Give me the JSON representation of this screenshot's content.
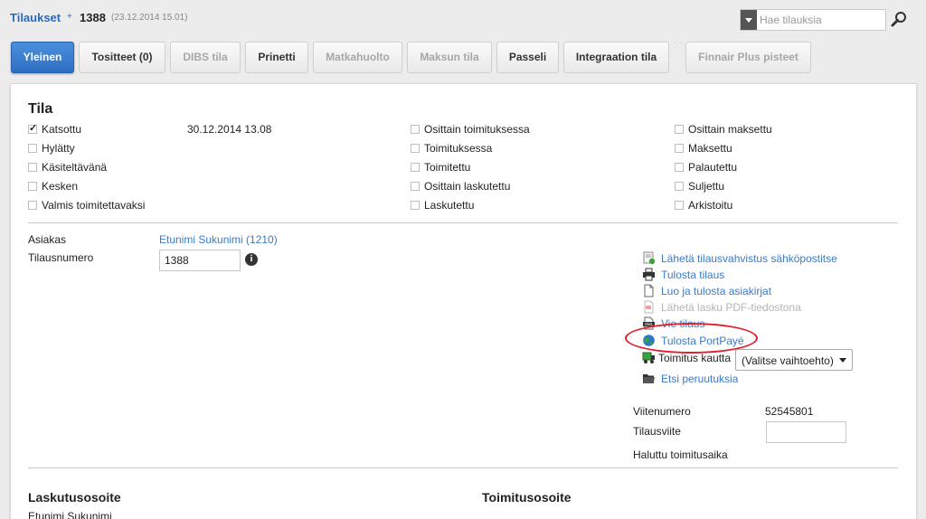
{
  "breadcrumb": {
    "root": "Tilaukset",
    "separator": "+",
    "order_number": "1388",
    "order_date": "(23.12.2014 15.01)"
  },
  "search": {
    "placeholder": "Hae tilauksia",
    "value": ""
  },
  "tabs": [
    {
      "label": "Yleinen",
      "state": "active"
    },
    {
      "label": "Tositteet (0)",
      "state": "enabled"
    },
    {
      "label": "DIBS tila",
      "state": "disabled"
    },
    {
      "label": "Prinetti",
      "state": "enabled"
    },
    {
      "label": "Matkahuolto",
      "state": "disabled"
    },
    {
      "label": "Maksun tila",
      "state": "disabled"
    },
    {
      "label": "Passeli",
      "state": "enabled"
    },
    {
      "label": "Integraation tila",
      "state": "enabled"
    },
    {
      "label": "Finnair Plus pisteet",
      "state": "disabled"
    }
  ],
  "status": {
    "heading": "Tila",
    "checked_date": "30.12.2014 13.08",
    "col1": [
      {
        "label": "Katsottu",
        "checked": true
      },
      {
        "label": "Hylätty",
        "checked": false
      },
      {
        "label": "Käsiteltävänä",
        "checked": false
      },
      {
        "label": "Kesken",
        "checked": false
      },
      {
        "label": "Valmis toimitettavaksi",
        "checked": false
      }
    ],
    "col2": [
      {
        "label": "Osittain toimituksessa",
        "checked": false
      },
      {
        "label": "Toimituksessa",
        "checked": false
      },
      {
        "label": "Toimitettu",
        "checked": false
      },
      {
        "label": "Osittain laskutettu",
        "checked": false
      },
      {
        "label": "Laskutettu",
        "checked": false
      }
    ],
    "col3": [
      {
        "label": "Osittain maksettu",
        "checked": false
      },
      {
        "label": "Maksettu",
        "checked": false
      },
      {
        "label": "Palautettu",
        "checked": false
      },
      {
        "label": "Suljettu",
        "checked": false
      },
      {
        "label": "Arkistoitu",
        "checked": false
      }
    ]
  },
  "customer": {
    "label": "Asiakas",
    "value": "Etunimi Sukunimi (1210)",
    "order_number_label": "Tilausnumero",
    "order_number_value": "1388"
  },
  "actions": [
    {
      "label": "Lähetä tilausvahvistus sähköpostitse",
      "icon": "email-icon",
      "enabled": true
    },
    {
      "label": "Tulosta tilaus",
      "icon": "printer-icon",
      "enabled": true
    },
    {
      "label": "Luo ja tulosta asiakirjat",
      "icon": "document-icon",
      "enabled": true
    },
    {
      "label": "Lähetä lasku PDF-tiedostona",
      "icon": "pdf-icon",
      "enabled": false
    },
    {
      "label": "Vie tilaus",
      "icon": "xml-icon",
      "enabled": true
    },
    {
      "label": "Tulosta PortPayé",
      "icon": "globe-icon",
      "enabled": true
    },
    {
      "label": "Toimitus kautta",
      "icon": "truck-icon",
      "enabled": true
    },
    {
      "label": "Etsi peruutuksia",
      "icon": "folder-icon",
      "enabled": true
    }
  ],
  "shipping_select": {
    "value": "(Valitse vaihtoehto)"
  },
  "reference": {
    "viitenumero_label": "Viitenumero",
    "viitenumero_value": "52545801",
    "tilausviite_label": "Tilausviite",
    "tilausviite_value": "",
    "delivery_time_label": "Haluttu toimitusaika"
  },
  "addresses": {
    "billing_heading": "Laskutusosoite",
    "billing_name": "Etunimi Sukunimi",
    "shipping_heading": "Toimitusosoite"
  },
  "colors": {
    "accent": "#2f6fc3",
    "link": "#3a7bc8",
    "annotation": "#e0202a"
  }
}
